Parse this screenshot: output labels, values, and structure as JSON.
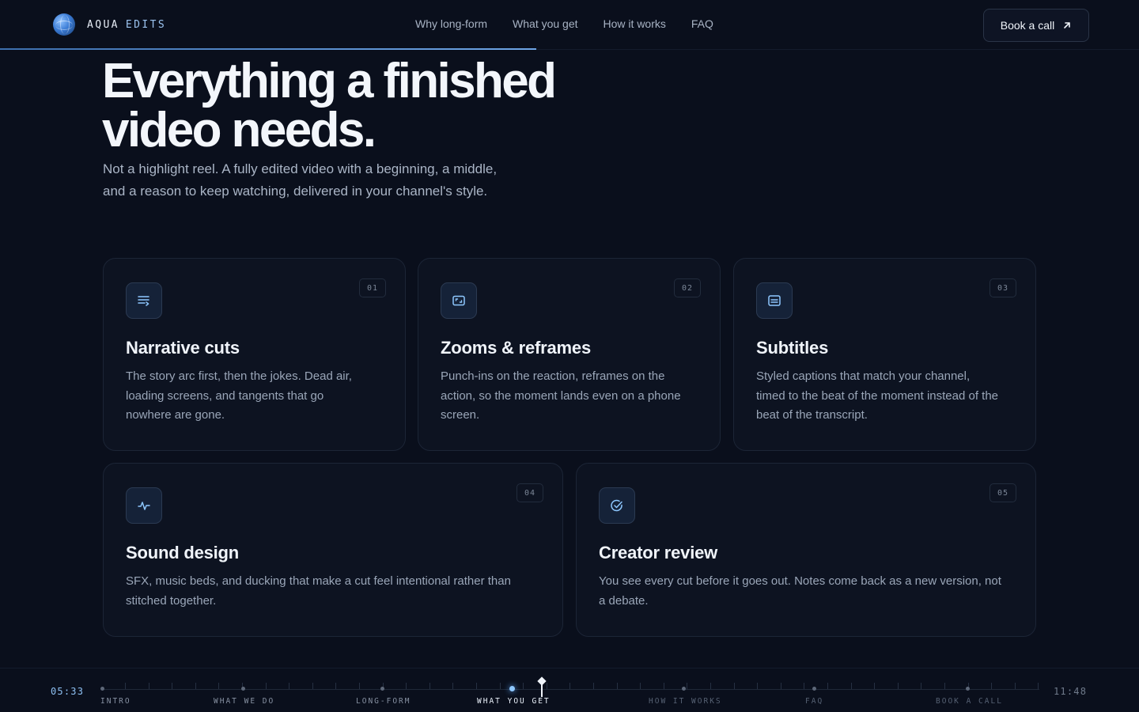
{
  "brand": {
    "name_a": "AQUA",
    "name_b": "EDITS",
    "logo_icon": "globe-icon"
  },
  "nav": {
    "links": [
      "Why long-form",
      "What you get",
      "How it works",
      "FAQ"
    ],
    "cta_label": "Book a call",
    "cta_icon": "arrow-up-right-icon"
  },
  "hero": {
    "title_line1": "Everything a finished",
    "title_line2": "video needs.",
    "subtitle_line1": "Not a highlight reel. A fully edited video with a beginning, a middle,",
    "subtitle_line2": "and a reason to keep watching, delivered in your channel's style."
  },
  "cards": [
    {
      "num": "01",
      "icon": "text-lines-icon",
      "title": "Narrative cuts",
      "desc_lines": [
        "The story arc first, then the jokes. Dead air,",
        "loading screens, and tangents that go",
        "nowhere are gone."
      ]
    },
    {
      "num": "02",
      "icon": "reframe-icon",
      "title": "Zooms & reframes",
      "desc_lines": [
        "Punch-ins on the reaction, reframes on the",
        "action, so the moment lands even on a phone",
        "screen."
      ]
    },
    {
      "num": "03",
      "icon": "subtitles-icon",
      "title": "Subtitles",
      "desc_lines": [
        "Styled captions that match your channel,",
        "timed to the beat of the moment instead of the",
        "beat of the transcript."
      ]
    },
    {
      "num": "04",
      "icon": "waveform-icon",
      "title": "Sound design",
      "desc_lines": [
        "SFX, music beds, and ducking that make a cut feel intentional rather than",
        "stitched together."
      ]
    },
    {
      "num": "05",
      "icon": "check-circle-icon",
      "title": "Creator review",
      "desc_lines": [
        "You see every cut before it goes out. Notes come back as a new version, not",
        "a debate."
      ]
    }
  ],
  "timeline": {
    "time_current": "05:33",
    "time_total": "11:48",
    "sections": [
      "INTRO",
      "WHAT WE DO",
      "LONG-FORM",
      "WHAT YOU GET",
      "HOW IT WORKS",
      "FAQ",
      "BOOK A CALL"
    ],
    "active_section": "WHAT YOU GET"
  },
  "colors": {
    "background": "#0a0f1c",
    "accent": "#8ec8ff",
    "card_bg": "#0d1321"
  }
}
